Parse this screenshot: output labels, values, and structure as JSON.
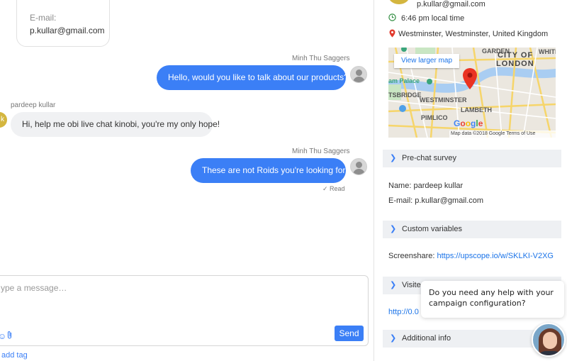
{
  "chat": {
    "email_card": {
      "label": "E-mail:",
      "value": "p.kullar@gmail.com"
    },
    "messages": [
      {
        "sender": "Minh Thu Saggers",
        "text": "Hello, would you like to talk about our products?"
      },
      {
        "sender": "pardeep kullar",
        "text": "Hi, help me obi live chat kinobi, you're my only hope!"
      },
      {
        "sender": "Minh Thu Saggers",
        "text": "These are not Roids you're looking for."
      }
    ],
    "visitor_avatar_letter": "k",
    "read_receipt": "✓ Read",
    "composer": {
      "placeholder": "ype a message…",
      "send_label": "Send"
    },
    "add_tag_label": "add tag"
  },
  "info": {
    "email_top": "p.kullar@gmail.com",
    "local_time": "6:46 pm local time",
    "location": "Westminster, Westminster, United Kingdom",
    "map": {
      "larger_label": "View larger map",
      "places": [
        "GARDEN",
        "CITY OF",
        "LONDON",
        "WHITE",
        "am Palace",
        "WESTMINSTER",
        "TSBRIDGE",
        "LAMBETH",
        "PIMLICO"
      ],
      "google": "Google",
      "attribution": "Map data ©2018 Google    Terms of Use"
    },
    "sections": {
      "prechat": "Pre-chat survey",
      "custom": "Custom variables",
      "visited": "Visite",
      "additional": "Additional info"
    },
    "name_label": "Name:",
    "name_value": "pardeep kullar",
    "email_label": "E-mail:",
    "email_value": "p.kullar@gmail.com",
    "screenshare_label": "Screenshare:",
    "screenshare_url": "https://upscope.io/w/SKLKI-V2XG",
    "visited_url": "http://0.0"
  },
  "tooltip": {
    "text": "Do you need any help with your campaign configuration?"
  },
  "colors": {
    "accent": "#3b7ff6",
    "link": "#1a73e8",
    "visitor_bubble": "#f0f1f3",
    "section_bg": "#eef0f3"
  },
  "icons": [
    "clock-icon",
    "location-pin-icon",
    "chevron-right-icon",
    "emoji-icon",
    "paperclip-icon",
    "check-icon"
  ]
}
